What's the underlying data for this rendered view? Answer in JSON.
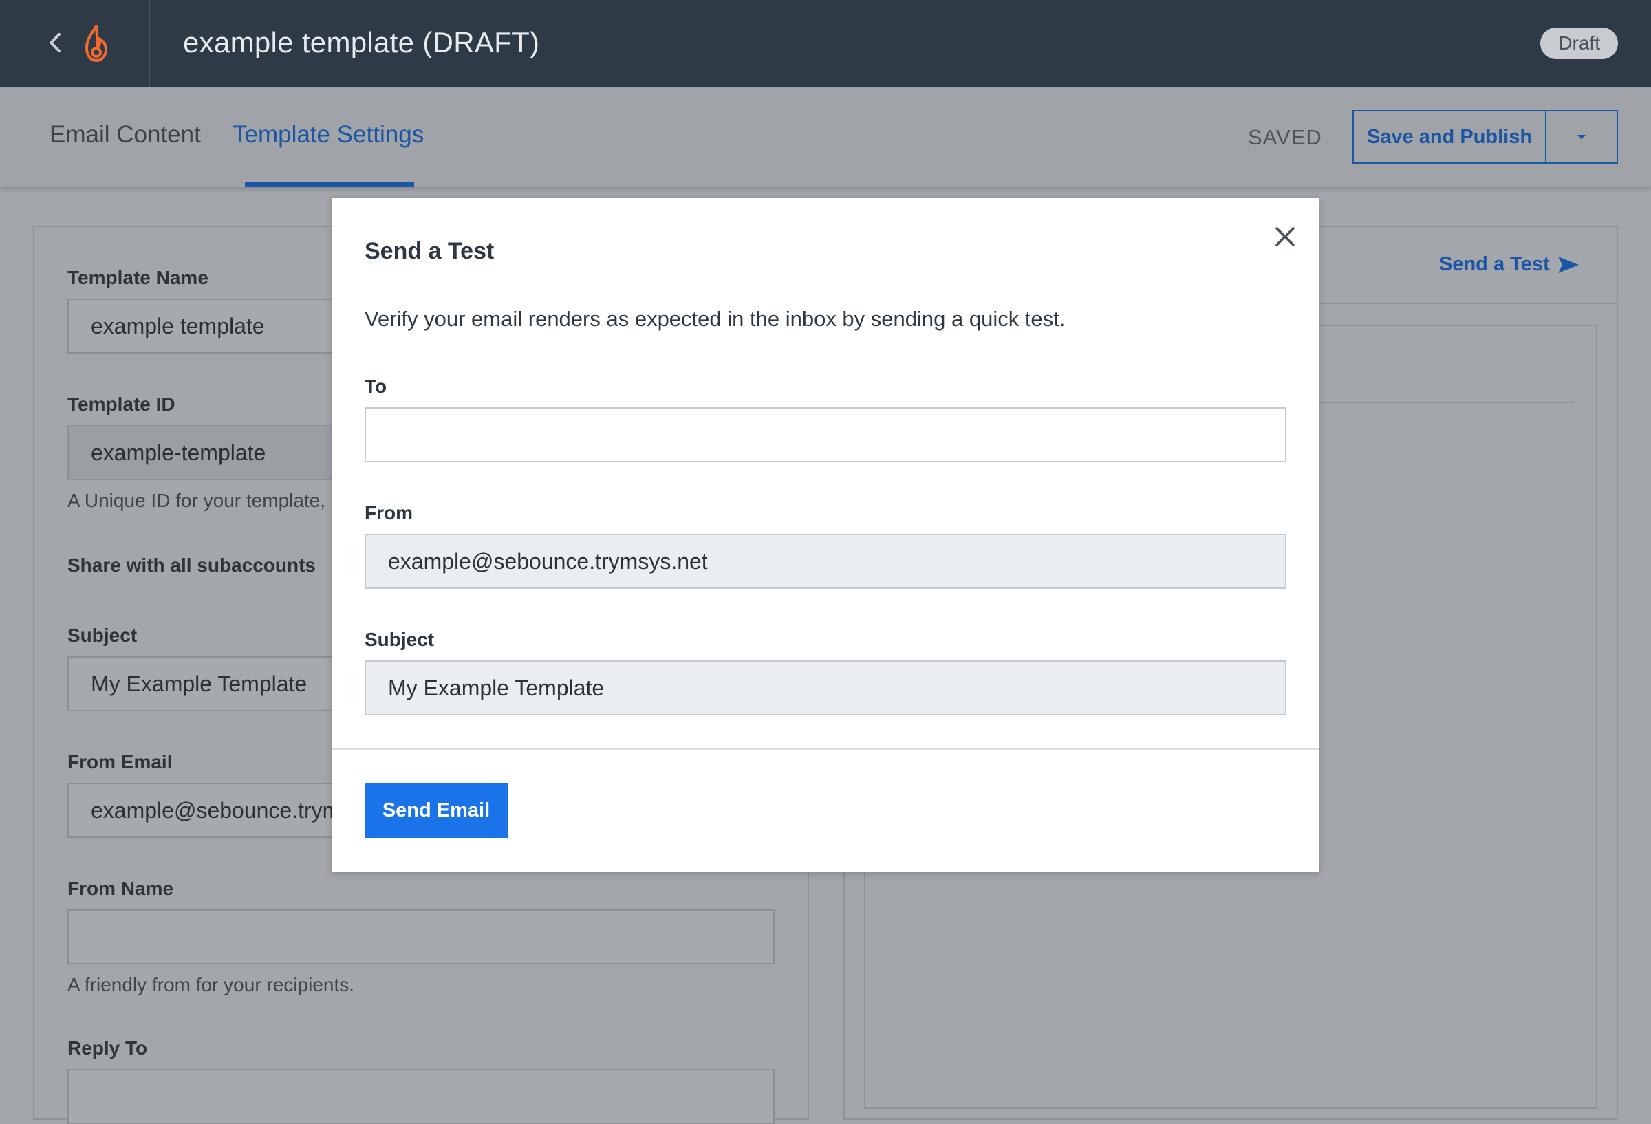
{
  "header": {
    "title": "example template (DRAFT)",
    "status_badge": "Draft"
  },
  "subnav": {
    "tabs": [
      {
        "label": "Email Content",
        "active": false
      },
      {
        "label": "Template Settings",
        "active": true
      }
    ],
    "saved_status": "SAVED",
    "publish_label": "Save and Publish"
  },
  "form": {
    "template_name_label": "Template Name",
    "template_name_value": "example template",
    "template_id_label": "Template ID",
    "template_id_value": "example-template",
    "template_id_help": "A Unique ID for your template,",
    "share_label": "Share with all subaccounts",
    "subject_label": "Subject",
    "subject_value": "My Example Template",
    "from_email_label": "From Email",
    "from_email_value": "example@sebounce.trymsys.net",
    "from_name_label": "From Name",
    "from_name_value": "",
    "from_name_help": "A friendly from for your recipients.",
    "reply_to_label": "Reply To",
    "reply_to_value": ""
  },
  "preview": {
    "send_test_link": "Send a Test"
  },
  "modal": {
    "title": "Send a Test",
    "description": "Verify your email renders as expected in the inbox by sending a quick test.",
    "to_label": "To",
    "to_value": "",
    "from_label": "From",
    "from_value": "example@sebounce.trymsys.net",
    "subject_label": "Subject",
    "subject_value": "My Example Template",
    "send_button": "Send Email"
  },
  "colors": {
    "header_bg": "#2f3a47",
    "accent_blue": "#1b55a6",
    "primary_button": "#1a73e8",
    "overlay": "#a3a6aa"
  },
  "icons": {
    "back": "chevron-left-icon",
    "logo": "flame-logo-icon",
    "caret": "caret-down-icon",
    "close": "close-icon",
    "send": "paper-plane-icon"
  }
}
